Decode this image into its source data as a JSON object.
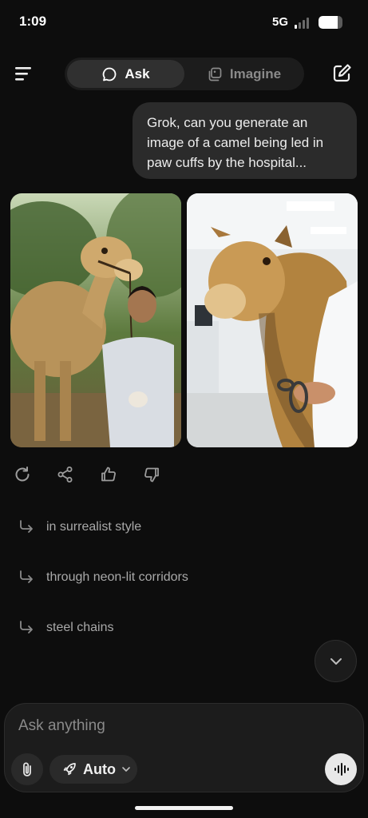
{
  "status": {
    "time": "1:09",
    "network": "5G",
    "battery_level": 0.8
  },
  "header": {
    "tabs": [
      {
        "label": "Ask",
        "icon": "chat-bubble-icon",
        "active": true
      },
      {
        "label": "Imagine",
        "icon": "images-icon",
        "active": false
      }
    ]
  },
  "conversation": {
    "user_message": "Grok, can you generate an image of a camel being led in paw cuffs by the hospital..."
  },
  "suggestions": [
    {
      "label": "in surrealist style"
    },
    {
      "label": "through neon-lit corridors"
    },
    {
      "label": "steel chains"
    }
  ],
  "composer": {
    "placeholder": "Ask anything",
    "model_label": "Auto"
  },
  "colors": {
    "background": "#0d0d0d",
    "bubble": "#2b2b2b",
    "accent_light": "#e8e8e8"
  }
}
